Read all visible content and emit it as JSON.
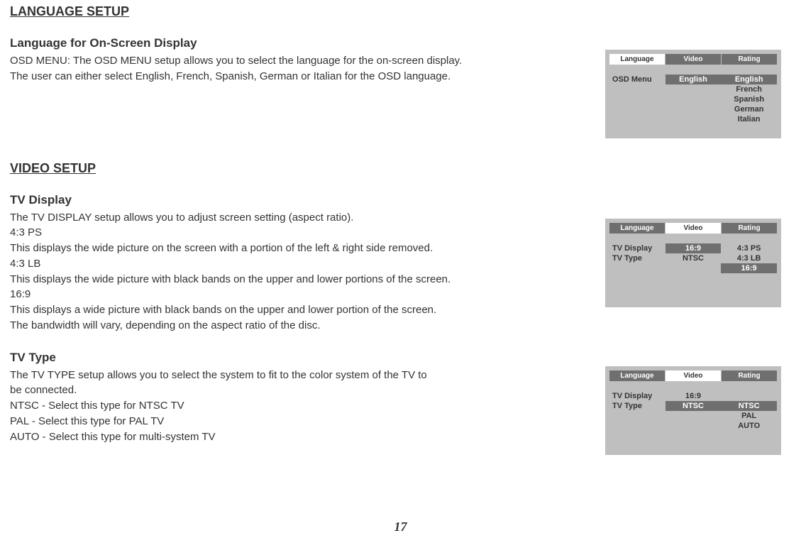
{
  "sections": {
    "language_setup": {
      "title": "LANGUAGE SETUP",
      "sub1_title": "Language for On-Screen Display",
      "sub1_text1": "OSD MENU: The OSD MENU setup allows you to select the language for the on-screen display.",
      "sub1_text2": "The user can either select English, French, Spanish, German or Italian for the OSD language."
    },
    "video_setup": {
      "title": "VIDEO SETUP",
      "tv_display": {
        "title": "TV Display",
        "l1": "The TV DISPLAY setup allows you to adjust screen setting (aspect ratio).",
        "l2": "4:3 PS",
        "l3": "This displays the wide picture on the screen with a portion of the left & right side removed.",
        "l4": "4:3 LB",
        "l5": "This displays the wide picture with black bands on the upper and lower portions of the screen.",
        "l6": "16:9",
        "l7": "This displays a wide picture with black bands on the upper and lower portion of the screen.",
        "l8": "The bandwidth will vary, depending on the aspect ratio of the disc."
      },
      "tv_type": {
        "title": "TV Type",
        "l1": "The TV TYPE setup allows you to select the system to fit to the color system of the TV to",
        "l2": "be connected.",
        "l3": "NTSC - Select this type for NTSC TV",
        "l4": "PAL - Select this type for PAL TV",
        "l5": "AUTO - Select this type for multi-system TV"
      }
    }
  },
  "panels": {
    "tabs": {
      "language": "Language",
      "video": "Video",
      "rating": "Rating"
    },
    "p1": {
      "label": "OSD Menu",
      "value": "English",
      "opts": [
        "English",
        "French",
        "Spanish",
        "German",
        "Italian"
      ],
      "selected_index": 0
    },
    "p2": {
      "labels": [
        "TV Display",
        "TV Type"
      ],
      "values": [
        "16:9",
        "NTSC"
      ],
      "value_highlight_index": 0,
      "opts": [
        "4:3 PS",
        "4:3 LB",
        "16:9"
      ],
      "selected_index": 2
    },
    "p3": {
      "labels": [
        "TV Display",
        "TV Type"
      ],
      "values": [
        "16:9",
        "NTSC"
      ],
      "value_highlight_index": 1,
      "opts": [
        "NTSC",
        "PAL",
        "AUTO"
      ],
      "selected_index": 0
    }
  },
  "page_number": "17"
}
